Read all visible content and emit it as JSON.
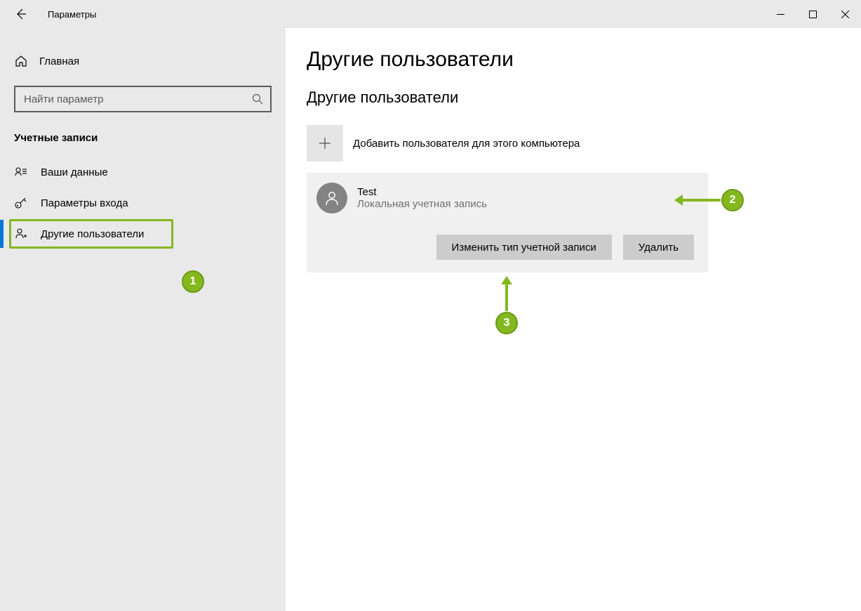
{
  "window": {
    "title": "Параметры"
  },
  "sidebar": {
    "home_label": "Главная",
    "search_placeholder": "Найти параметр",
    "section_label": "Учетные записи",
    "items": [
      {
        "label": "Ваши данные"
      },
      {
        "label": "Параметры входа"
      },
      {
        "label": "Другие пользователи"
      }
    ]
  },
  "content": {
    "page_title": "Другие пользователи",
    "section_title": "Другие пользователи",
    "add_user_label": "Добавить пользователя для этого компьютера",
    "user": {
      "name": "Test",
      "subtitle": "Локальная учетная запись"
    },
    "buttons": {
      "change_type": "Изменить тип учетной записи",
      "delete": "Удалить"
    }
  },
  "callouts": {
    "c1": "1",
    "c2": "2",
    "c3": "3"
  }
}
